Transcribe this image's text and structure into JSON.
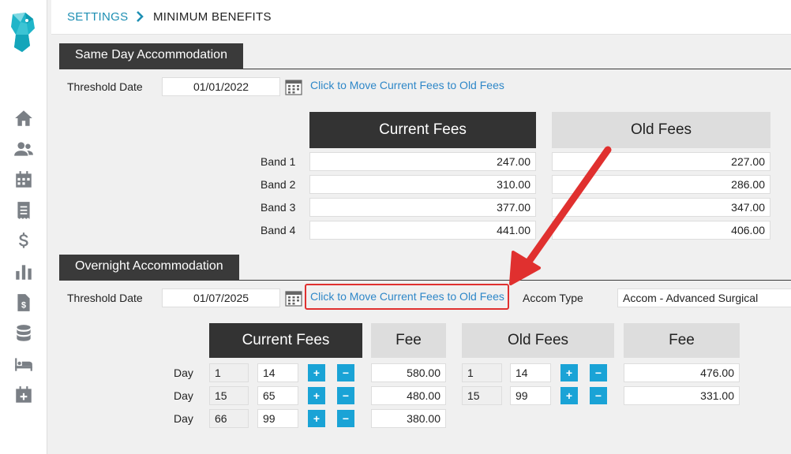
{
  "breadcrumb": {
    "parent": "SETTINGS",
    "current": "MINIMUM BENEFITS"
  },
  "sidebar": {
    "icons": [
      "home-icon",
      "users-icon",
      "calendar-icon",
      "receipt-icon",
      "dollar-icon",
      "bar-chart-icon",
      "invoice-icon",
      "database-icon",
      "bed-icon",
      "calendar-add-icon"
    ]
  },
  "same_day": {
    "title": "Same Day Accommodation",
    "threshold_label": "Threshold Date",
    "threshold_date": "01/01/2022",
    "move_link": "Click to Move Current Fees to Old Fees",
    "current_header": "Current Fees",
    "old_header": "Old Fees",
    "bands": [
      {
        "label": "Band 1",
        "current": "247.00",
        "old": "227.00"
      },
      {
        "label": "Band 2",
        "current": "310.00",
        "old": "286.00"
      },
      {
        "label": "Band 3",
        "current": "377.00",
        "old": "347.00"
      },
      {
        "label": "Band 4",
        "current": "441.00",
        "old": "406.00"
      }
    ]
  },
  "overnight": {
    "title": "Overnight Accommodation",
    "threshold_label": "Threshold Date",
    "threshold_date": "01/07/2025",
    "move_link": "Click to Move Current Fees to Old Fees",
    "accom_type_label": "Accom Type",
    "accom_type_value": "Accom - Advanced Surgical",
    "current_header": "Current Fees",
    "fee_header": "Fee",
    "old_header": "Old Fees",
    "old_fee_header": "Fee",
    "plus": "+",
    "minus": "−",
    "rows": [
      {
        "label": "Day",
        "from": "1",
        "to": "14",
        "fee": "580.00",
        "old_from": "1",
        "old_to": "14",
        "old_fee": "476.00"
      },
      {
        "label": "Day",
        "from": "15",
        "to": "65",
        "fee": "480.00",
        "old_from": "15",
        "old_to": "99",
        "old_fee": "331.00"
      },
      {
        "label": "Day",
        "from": "66",
        "to": "99",
        "fee": "380.00"
      }
    ]
  },
  "colors": {
    "accent": "#1aa3d6",
    "link": "#2e87c8",
    "dark_header": "#333333",
    "annotation": "#e0302f"
  }
}
